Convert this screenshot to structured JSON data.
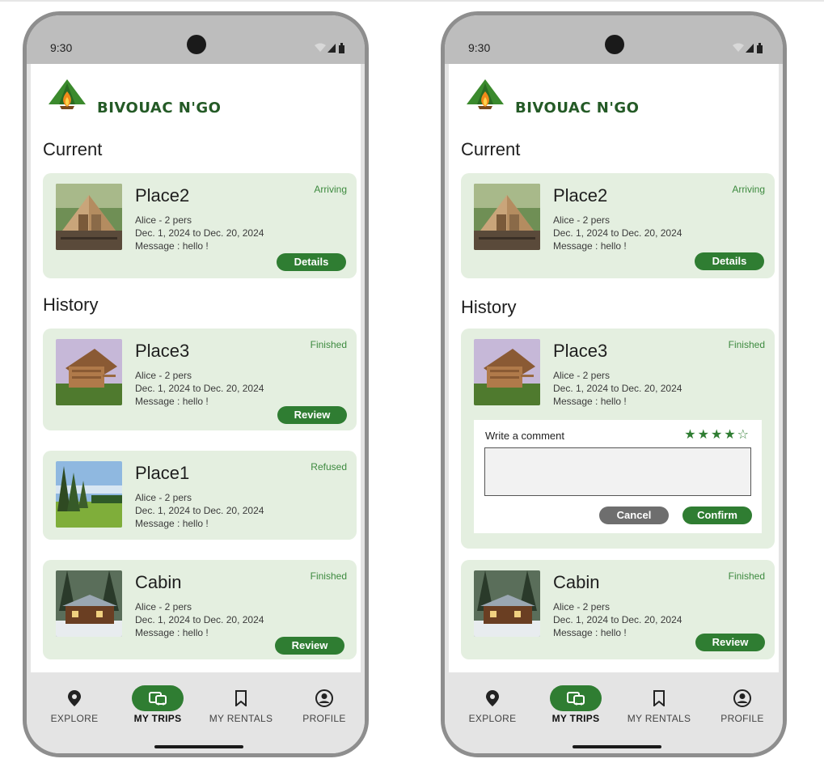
{
  "phones": [
    {
      "status_bar": {
        "time": "9:30"
      },
      "app": {
        "brand": "BIVOUAC N'GO"
      },
      "current_heading": "Current",
      "current": {
        "title": "Place2",
        "status": "Arriving",
        "guest": "Alice - 2 pers",
        "dates": "Dec. 1, 2024 to Dec. 20, 2024",
        "message": "Message : hello !",
        "button": "Details"
      },
      "history_heading": "History",
      "history": [
        {
          "title": "Place3",
          "status": "Finished",
          "guest": "Alice - 2 pers",
          "dates": "Dec. 1, 2024 to Dec. 20, 2024",
          "message": "Message : hello !",
          "button": "Review"
        },
        {
          "title": "Place1",
          "status": "Refused",
          "guest": "Alice - 2 pers",
          "dates": "Dec. 1, 2024 to Dec. 20, 2024",
          "message": "Message : hello !"
        },
        {
          "title": "Cabin",
          "status": "Finished",
          "guest": "Alice - 2 pers",
          "dates": "Dec. 1, 2024 to Dec. 20, 2024",
          "message": "Message : hello !",
          "button": "Review"
        }
      ],
      "nav": [
        {
          "label": "EXPLORE",
          "icon": "location-pin-icon",
          "active": false
        },
        {
          "label": "MY TRIPS",
          "icon": "trips-icon",
          "active": true
        },
        {
          "label": "MY RENTALS",
          "icon": "bookmark-icon",
          "active": false
        },
        {
          "label": "PROFILE",
          "icon": "profile-icon",
          "active": false
        }
      ]
    },
    {
      "status_bar": {
        "time": "9:30"
      },
      "app": {
        "brand": "BIVOUAC N'GO"
      },
      "current_heading": "Current",
      "current": {
        "title": "Place2",
        "status": "Arriving",
        "guest": "Alice - 2 pers",
        "dates": "Dec. 1, 2024 to Dec. 20, 2024",
        "message": "Message : hello !",
        "button": "Details"
      },
      "history_heading": "History",
      "history": [
        {
          "title": "Place3",
          "status": "Finished",
          "guest": "Alice - 2 pers",
          "dates": "Dec. 1, 2024 to Dec. 20, 2024",
          "message": "Message : hello !",
          "review": {
            "label": "Write a comment",
            "stars": "★★★★☆",
            "rating": 4,
            "max_rating": 5,
            "text": "",
            "cancel": "Cancel",
            "confirm": "Confirm"
          }
        },
        {
          "title": "Cabin",
          "status": "Finished",
          "guest": "Alice - 2 pers",
          "dates": "Dec. 1, 2024 to Dec. 20, 2024",
          "message": "Message : hello !",
          "button": "Review"
        }
      ],
      "nav": [
        {
          "label": "EXPLORE",
          "icon": "location-pin-icon",
          "active": false
        },
        {
          "label": "MY TRIPS",
          "icon": "trips-icon",
          "active": true
        },
        {
          "label": "MY RENTALS",
          "icon": "bookmark-icon",
          "active": false
        },
        {
          "label": "PROFILE",
          "icon": "profile-icon",
          "active": false
        }
      ]
    }
  ],
  "colors": {
    "accent": "#2f7d32",
    "card_bg": "#e4efe0",
    "status_text": "#3d8a3f",
    "cancel_button": "#6e6e6e"
  }
}
